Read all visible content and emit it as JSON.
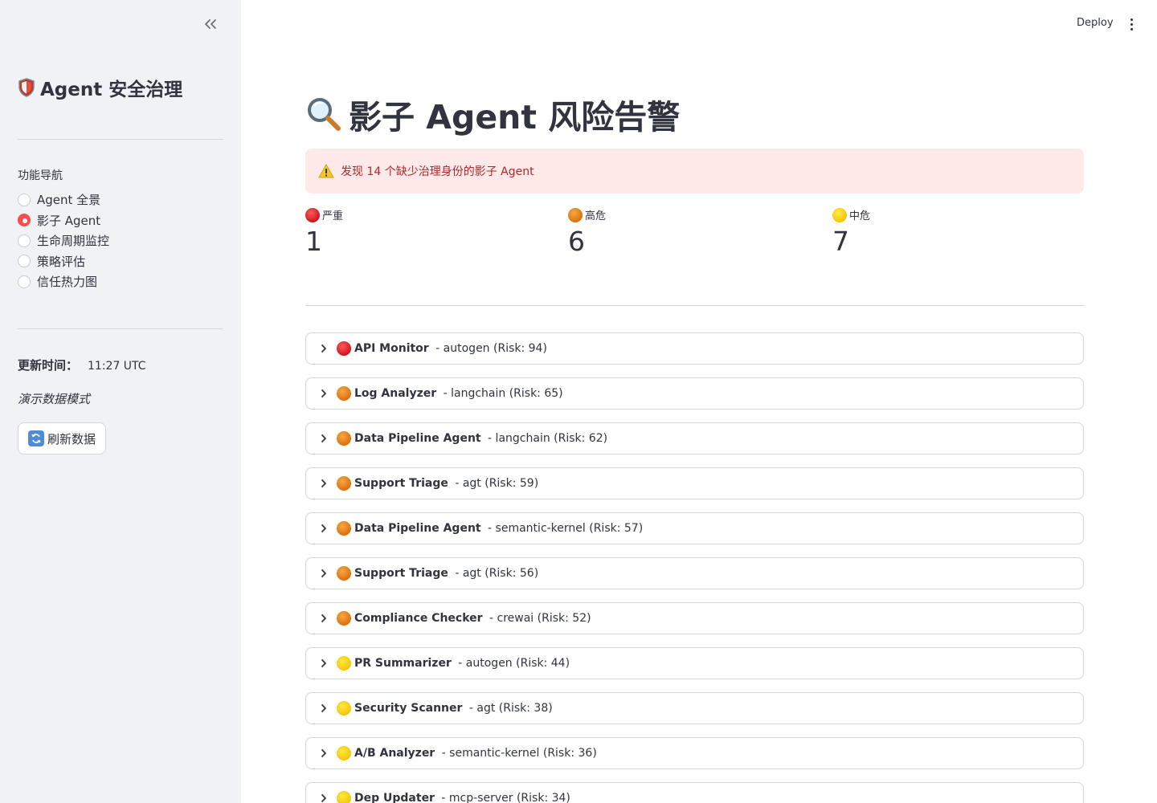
{
  "sidebar": {
    "title": "Agent 安全治理",
    "nav_label": "功能导航",
    "nav_items": [
      {
        "label": "Agent 全景",
        "selected": false
      },
      {
        "label": "影子 Agent",
        "selected": true
      },
      {
        "label": "生命周期监控",
        "selected": false
      },
      {
        "label": "策略评估",
        "selected": false
      },
      {
        "label": "信任热力图",
        "selected": false
      }
    ],
    "update_label": "更新时间：",
    "update_value": "11:27 UTC",
    "demo_mode": "演示数据模式",
    "refresh_label": "刷新数据"
  },
  "header": {
    "deploy_label": "Deploy"
  },
  "main": {
    "title": "影子 Agent 风险告警",
    "alert_text": "发现 14 个缺少治理身份的影子 Agent",
    "metrics": [
      {
        "label": "严重",
        "value": "1",
        "level": "critical"
      },
      {
        "label": "高危",
        "value": "6",
        "level": "high"
      },
      {
        "label": "中危",
        "value": "7",
        "level": "medium"
      }
    ],
    "agents": [
      {
        "name": "API Monitor",
        "detail": " - autogen (Risk: 94)",
        "level": "critical"
      },
      {
        "name": "Log Analyzer",
        "detail": " - langchain (Risk: 65)",
        "level": "high"
      },
      {
        "name": "Data Pipeline Agent",
        "detail": " - langchain (Risk: 62)",
        "level": "high"
      },
      {
        "name": "Support Triage",
        "detail": " - agt (Risk: 59)",
        "level": "high"
      },
      {
        "name": "Data Pipeline Agent",
        "detail": " - semantic-kernel (Risk: 57)",
        "level": "high"
      },
      {
        "name": "Support Triage",
        "detail": " - agt (Risk: 56)",
        "level": "high"
      },
      {
        "name": "Compliance Checker",
        "detail": " - crewai (Risk: 52)",
        "level": "high"
      },
      {
        "name": "PR Summarizer",
        "detail": " - autogen (Risk: 44)",
        "level": "medium"
      },
      {
        "name": "Security Scanner",
        "detail": " - agt (Risk: 38)",
        "level": "medium"
      },
      {
        "name": "A/B Analyzer",
        "detail": " - semantic-kernel (Risk: 36)",
        "level": "medium"
      },
      {
        "name": "Dep Updater",
        "detail": " - mcp-server (Risk: 34)",
        "level": "medium"
      }
    ]
  },
  "colors": {
    "sidebar_bg": "#f0f2f6",
    "accent": "#ff4b4b",
    "alert_bg": "#ffe9e9",
    "alert_text": "#b3262b"
  }
}
